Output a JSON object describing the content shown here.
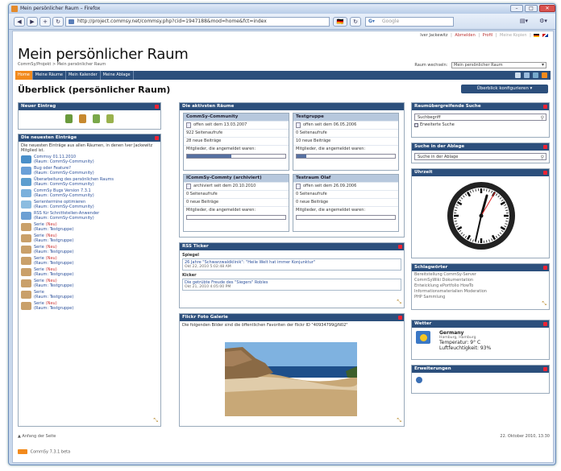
{
  "window": {
    "title": "Mein persönlicher Raum – Firefox",
    "minimize": "–",
    "maximize": "□",
    "close": "✕"
  },
  "nav": {
    "back": "◀",
    "forward": "▶",
    "plus": "+",
    "reload": "↻",
    "url": "http://project.commsy.net/commsy.php?cid=1947188&mod=home&fct=index",
    "search_placeholder": "Google",
    "page_menu": "▤▾",
    "tools_menu": "⚙▾"
  },
  "top_links": {
    "user": "Iver Jackewitz",
    "logout": "Abmelden",
    "profile": "Profil",
    "clipboard": "Meine Kopien"
  },
  "app": {
    "title": "Mein persönlicher Raum",
    "breadcrumb": "CommSy/Projekt > Mein persönlicher Raum",
    "room_switch_label": "Raum wechseln:",
    "room_switch_value": "Mein persönlicher Raum"
  },
  "tabs": [
    "Home",
    "Meine Räume",
    "Mein Kalender",
    "Meine Ablage"
  ],
  "page": {
    "heading": "Überblick (persönlicher Raum)",
    "configure_button": "Überblick konfigurieren"
  },
  "new_entry": {
    "title": "Neuer Eintrag"
  },
  "newest": {
    "title": "Die neuesten Einträge",
    "intro": "Die neuesten Einträge aus allen Räumen, in denen Iver Jackewitz Mitglied ist.",
    "items": [
      {
        "title": "Commsy 01.11.2010",
        "room": "(Raum: CommSy-Community)",
        "badge": ""
      },
      {
        "title": "Bug oder Feature?",
        "room": "(Raum: CommSy-Community)",
        "badge": ""
      },
      {
        "title": "Überarbeitung des persönlichen Raums",
        "room": "(Raum: CommSy-Community)",
        "badge": ""
      },
      {
        "title": "CommSy Bugs Version 7.3.1",
        "room": "(Raum: CommSy-Community)",
        "badge": ""
      },
      {
        "title": "Serientermine optimieren",
        "room": "(Raum: CommSy-Community)",
        "badge": ""
      },
      {
        "title": "RSS für Schnittstellen-Anwender",
        "room": "(Raum: CommSy-Community)",
        "badge": ""
      },
      {
        "title": "Serie",
        "room": "(Raum: Testgruppe)",
        "badge": "(Neu)"
      },
      {
        "title": "Serie",
        "room": "(Raum: Testgruppe)",
        "badge": "(Neu)"
      },
      {
        "title": "Serie",
        "room": "(Raum: Testgruppe)",
        "badge": "(Neu)"
      },
      {
        "title": "Serie",
        "room": "(Raum: Testgruppe)",
        "badge": "(Neu)"
      },
      {
        "title": "Serie",
        "room": "(Raum: Testgruppe)",
        "badge": "(Neu)"
      },
      {
        "title": "Serie",
        "room": "(Raum: Testgruppe)",
        "badge": "(Neu)"
      },
      {
        "title": "Serie",
        "room": "(Raum: Testgruppe)",
        "badge": ""
      },
      {
        "title": "Serie",
        "room": "(Raum: Testgruppe)",
        "badge": "(Neu)"
      }
    ]
  },
  "active_rooms": {
    "title": "Die aktivsten Räume",
    "members_label": "Mitglieder, die angemeldet waren:",
    "rooms": [
      {
        "name": "CommSy-Community",
        "since": "offen seit dem 13.03.2007",
        "views": "922 Seitenaufrufe",
        "posts": "28 neue Beiträge",
        "fill": 0.45
      },
      {
        "name": "Testgruppe",
        "since": "offen seit dem 06.05.2006",
        "views": "0 Seitenaufrufe",
        "posts": "10 neue Beiträge",
        "fill": 0.1
      },
      {
        "name": "ICommSy-Commty (archiviert)",
        "since": "archiviert seit dem 20.10.2010",
        "views": "0 Seitenaufrufe",
        "posts": "0 neue Beiträge",
        "fill": 0.0
      },
      {
        "name": "Testraum Olaf",
        "since": "offen seit dem 26.09.2006",
        "views": "0 Seitenaufrufe",
        "posts": "0 neue Beiträge",
        "fill": 0.0
      }
    ]
  },
  "rss": {
    "title": "RSS Ticker",
    "feeds": [
      {
        "source": "Spiegel",
        "headline": "26 Jahre \"Schwarzwaldklinik\": \"Heile Welt hat immer Konjunktur\"",
        "date": "Okt 22, 2010 5:02:48 AM"
      },
      {
        "source": "Kicker",
        "headline": "Die getrübte Freude des \"Siegers\" Robles",
        "date": "Okt 21, 2010 4:05:00 PM"
      }
    ]
  },
  "flickr": {
    "title": "Flickr Foto Galerie",
    "caption": "Die folgenden Bilder sind die öffentlichen Favoriten der flickr ID \"40934799@N02\""
  },
  "cross_search": {
    "title": "Raumübergreifende Suche",
    "value": "Suchbegriff",
    "extended": "Erweiterte Suche"
  },
  "clipboard_search": {
    "title": "Suche in der Ablage",
    "value": "Suche in der Ablage"
  },
  "clock": {
    "title": "Uhrzeit"
  },
  "tags": {
    "title": "Schlagwörter",
    "lines": [
      "Bereitstellung  CommSy-Server",
      "CommSyWiki  Dokumentation",
      "Entwicklung  ePortfolio  HowTo",
      "Informationsmaterialien  Moderation",
      "PHP  Sammlung"
    ]
  },
  "weather": {
    "title": "Wetter",
    "country": "Germany",
    "city": "Hamburg, Hamburg",
    "temp": "Temperatur: 9° C",
    "humidity": "Luftfeuchtigkeit: 93%"
  },
  "extensions": {
    "title": "Erweiterungen"
  },
  "footer": {
    "top_link": "▲ Anfang der Seite",
    "datetime": "22. Oktober 2010, 13:30",
    "version": "CommSy 7.3.1 beta"
  },
  "colors": {
    "header_blue": "#2c4f7c",
    "accent_orange": "#f28a1c",
    "link": "#2a4f9a"
  }
}
